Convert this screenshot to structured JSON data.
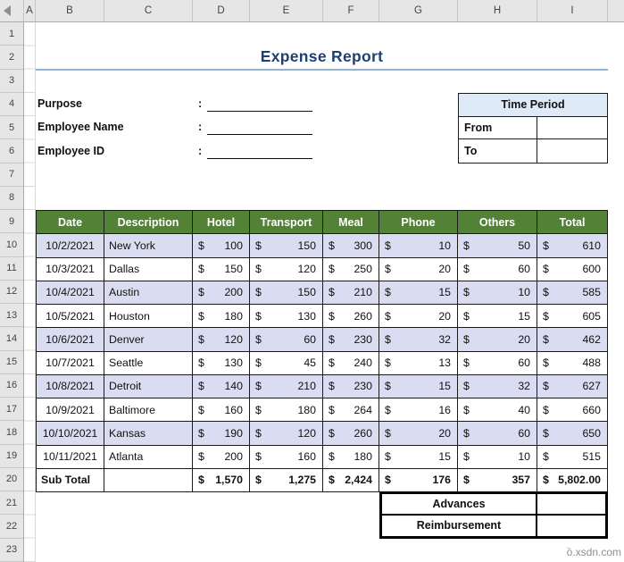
{
  "sheet": {
    "columns": [
      "A",
      "B",
      "C",
      "D",
      "E",
      "F",
      "G",
      "H",
      "I"
    ],
    "row_numbers": [
      "1",
      "2",
      "3",
      "4",
      "5",
      "6",
      "7",
      "8",
      "9",
      "10",
      "11",
      "12",
      "13",
      "14",
      "15",
      "16",
      "17",
      "18",
      "19",
      "20",
      "21",
      "22",
      "23"
    ]
  },
  "title": {
    "text": "Expense Report"
  },
  "form": {
    "colon": ":",
    "purpose_label": "Purpose",
    "employee_name_label": "Employee Name",
    "employee_id_label": "Employee ID",
    "purpose_value": "",
    "employee_name_value": "",
    "employee_id_value": ""
  },
  "time_period": {
    "header": "Time Period",
    "from_label": "From",
    "to_label": "To",
    "from_value": "",
    "to_value": ""
  },
  "expense_table": {
    "currency": "$",
    "headers": [
      "Date",
      "Description",
      "Hotel",
      "Transport",
      "Meal",
      "Phone",
      "Others",
      "Total"
    ],
    "rows": [
      {
        "date": "10/2/2021",
        "description": "New York",
        "hotel": "100",
        "transport": "150",
        "meal": "300",
        "phone": "10",
        "others": "50",
        "total": "610"
      },
      {
        "date": "10/3/2021",
        "description": "Dallas",
        "hotel": "150",
        "transport": "120",
        "meal": "250",
        "phone": "20",
        "others": "60",
        "total": "600"
      },
      {
        "date": "10/4/2021",
        "description": "Austin",
        "hotel": "200",
        "transport": "150",
        "meal": "210",
        "phone": "15",
        "others": "10",
        "total": "585"
      },
      {
        "date": "10/5/2021",
        "description": "Houston",
        "hotel": "180",
        "transport": "130",
        "meal": "260",
        "phone": "20",
        "others": "15",
        "total": "605"
      },
      {
        "date": "10/6/2021",
        "description": "Denver",
        "hotel": "120",
        "transport": "60",
        "meal": "230",
        "phone": "32",
        "others": "20",
        "total": "462"
      },
      {
        "date": "10/7/2021",
        "description": "Seattle",
        "hotel": "130",
        "transport": "45",
        "meal": "240",
        "phone": "13",
        "others": "60",
        "total": "488"
      },
      {
        "date": "10/8/2021",
        "description": "Detroit",
        "hotel": "140",
        "transport": "210",
        "meal": "230",
        "phone": "15",
        "others": "32",
        "total": "627"
      },
      {
        "date": "10/9/2021",
        "description": "Baltimore",
        "hotel": "160",
        "transport": "180",
        "meal": "264",
        "phone": "16",
        "others": "40",
        "total": "660"
      },
      {
        "date": "10/10/2021",
        "description": "Kansas",
        "hotel": "190",
        "transport": "120",
        "meal": "260",
        "phone": "20",
        "others": "60",
        "total": "650"
      },
      {
        "date": "10/11/2021",
        "description": "Atlanta",
        "hotel": "200",
        "transport": "160",
        "meal": "180",
        "phone": "15",
        "others": "10",
        "total": "515"
      }
    ],
    "subtotal": {
      "label": "Sub Total",
      "description": "",
      "hotel": "1,570",
      "transport": "1,275",
      "meal": "2,424",
      "phone": "176",
      "others": "357",
      "total": "5,802.00"
    }
  },
  "extras": {
    "advances_label": "Advances",
    "reimbursement_label": "Reimbursement",
    "advances_value": "",
    "reimbursement_value": ""
  },
  "watermark": {
    "text": "ồ.xsdn.com"
  },
  "colors": {
    "header_green": "#538135",
    "banded_row": "#DADDF1",
    "time_period_fill": "#DEEBF7",
    "title_blue": "#1F4073",
    "title_underline": "#95B3D7"
  }
}
